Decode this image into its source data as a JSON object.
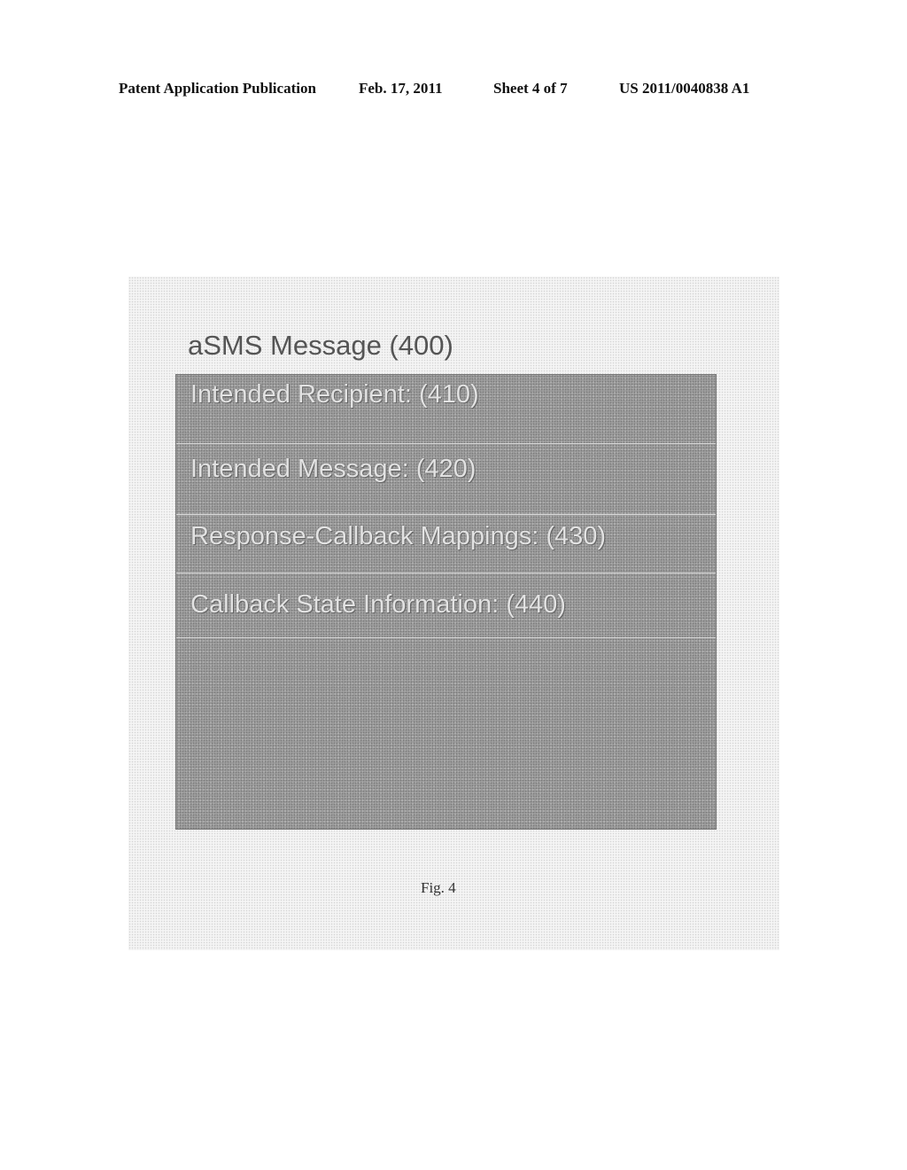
{
  "header": {
    "publication_type": "Patent Application Publication",
    "date": "Feb. 17, 2011",
    "sheet": "Sheet 4 of 7",
    "patent_number": "US 2011/0040838 A1"
  },
  "figure": {
    "title": "aSMS Message (400)",
    "rows": [
      {
        "label": "Intended Recipient: (410)"
      },
      {
        "label": "Intended Message: (420)"
      },
      {
        "label": "Response-Callback Mappings: (430)"
      },
      {
        "label": "Callback State Information: (440)"
      }
    ],
    "caption": "Fig. 4"
  }
}
